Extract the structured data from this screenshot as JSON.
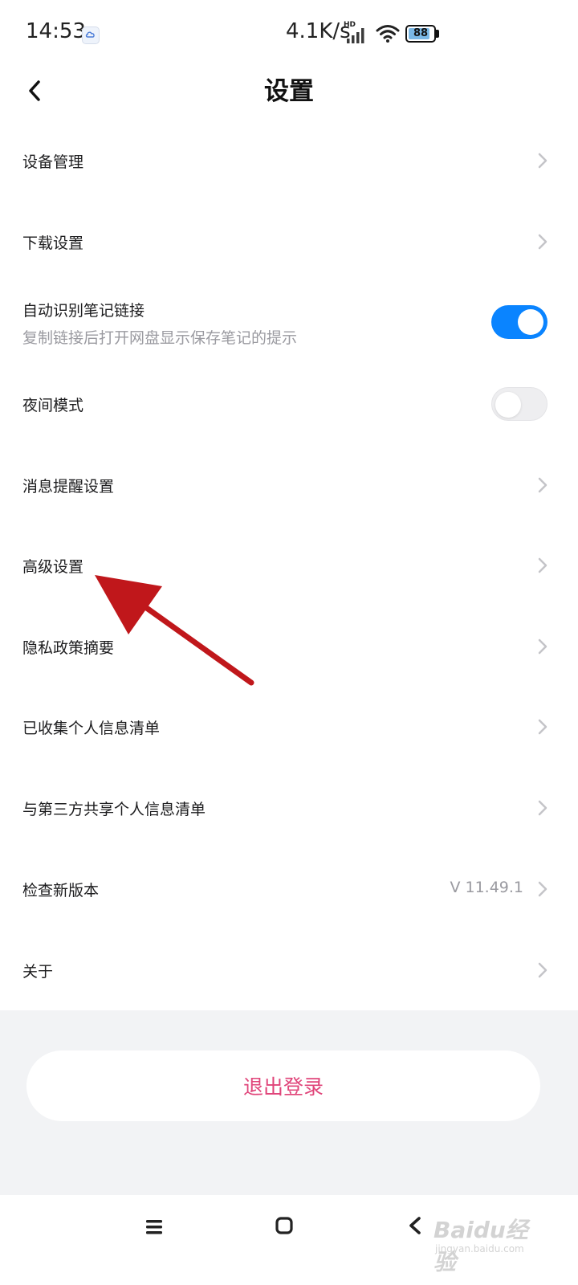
{
  "status_bar": {
    "time": "14:53",
    "net_speed": "4.1K/s",
    "hd_label": "HD",
    "battery_level": "88",
    "battery_fraction": 0.88
  },
  "header": {
    "title": "设置",
    "back_icon": "chevron-left-icon"
  },
  "settings": {
    "items": [
      {
        "label": "设备管理",
        "type": "link"
      },
      {
        "label": "下载设置",
        "type": "link"
      },
      {
        "label": "自动识别笔记链接",
        "sublabel": "复制链接后打开网盘显示保存笔记的提示",
        "type": "toggle",
        "on": true
      },
      {
        "label": "夜间模式",
        "type": "toggle",
        "on": false
      },
      {
        "label": "消息提醒设置",
        "type": "link"
      },
      {
        "label": "高级设置",
        "type": "link"
      },
      {
        "label": "隐私政策摘要",
        "type": "link"
      },
      {
        "label": "已收集个人信息清单",
        "type": "link"
      },
      {
        "label": "与第三方共享个人信息清单",
        "type": "link"
      },
      {
        "label": "检查新版本",
        "value": "V 11.49.1",
        "type": "link"
      },
      {
        "label": "关于",
        "type": "link"
      }
    ]
  },
  "logout": {
    "label": "退出登录"
  },
  "colors": {
    "accent": "#0a84ff",
    "logout_text": "#e0457a",
    "annotation_arrow": "#c0171b",
    "toggle_off": "#eeeef0"
  },
  "watermark": {
    "logo": "Baidu经验",
    "sub": "jingyan.baidu.com"
  }
}
